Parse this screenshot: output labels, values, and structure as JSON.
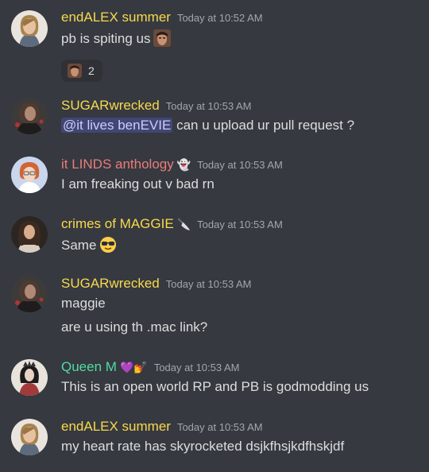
{
  "colors": {
    "background": "#36393f",
    "name_yellow": "#f8d94e",
    "name_pink": "#e97c7c",
    "name_teal": "#4fdca2",
    "mention_bg": "#414675",
    "mention_text": "#c9cdfb",
    "timestamp": "#a3a6aa"
  },
  "messages": [
    {
      "username": "endALEX summer",
      "timestamp": "Today at 10:52 AM",
      "lines": [
        "pb is spiting us"
      ],
      "inline_emoji": "custom-face-emoji",
      "reaction": {
        "emoji": "custom-face-emoji",
        "count": "2"
      }
    },
    {
      "username": "SUGARwrecked",
      "timestamp": "Today at 10:53 AM",
      "mention": "@it lives benEVIE",
      "lines": [
        "can u upload ur pull request ?"
      ]
    },
    {
      "username": "it LINDS anthology",
      "badge": "ghost-icon",
      "timestamp": "Today at 10:53 AM",
      "lines": [
        "I am freaking out v bad rn"
      ]
    },
    {
      "username": "crimes of MAGGIE",
      "badge": "knife-icon",
      "timestamp": "Today at 10:53 AM",
      "lines": [
        "Same"
      ],
      "inline_emoji": "sunglasses-emoji"
    },
    {
      "username": "SUGARwrecked",
      "timestamp": "Today at 10:53 AM",
      "lines": [
        "maggie",
        "are u using th .mac link?"
      ]
    },
    {
      "username": "Queen M",
      "badge": "purple-heart-icon",
      "timestamp": "Today at 10:53 AM",
      "lines": [
        "This is an open world RP and PB is godmodding us"
      ]
    },
    {
      "username": "endALEX summer",
      "timestamp": "Today at 10:53 AM",
      "lines": [
        "my heart rate has skyrocketed dsjkfhsjkdfhskjdf"
      ]
    }
  ]
}
